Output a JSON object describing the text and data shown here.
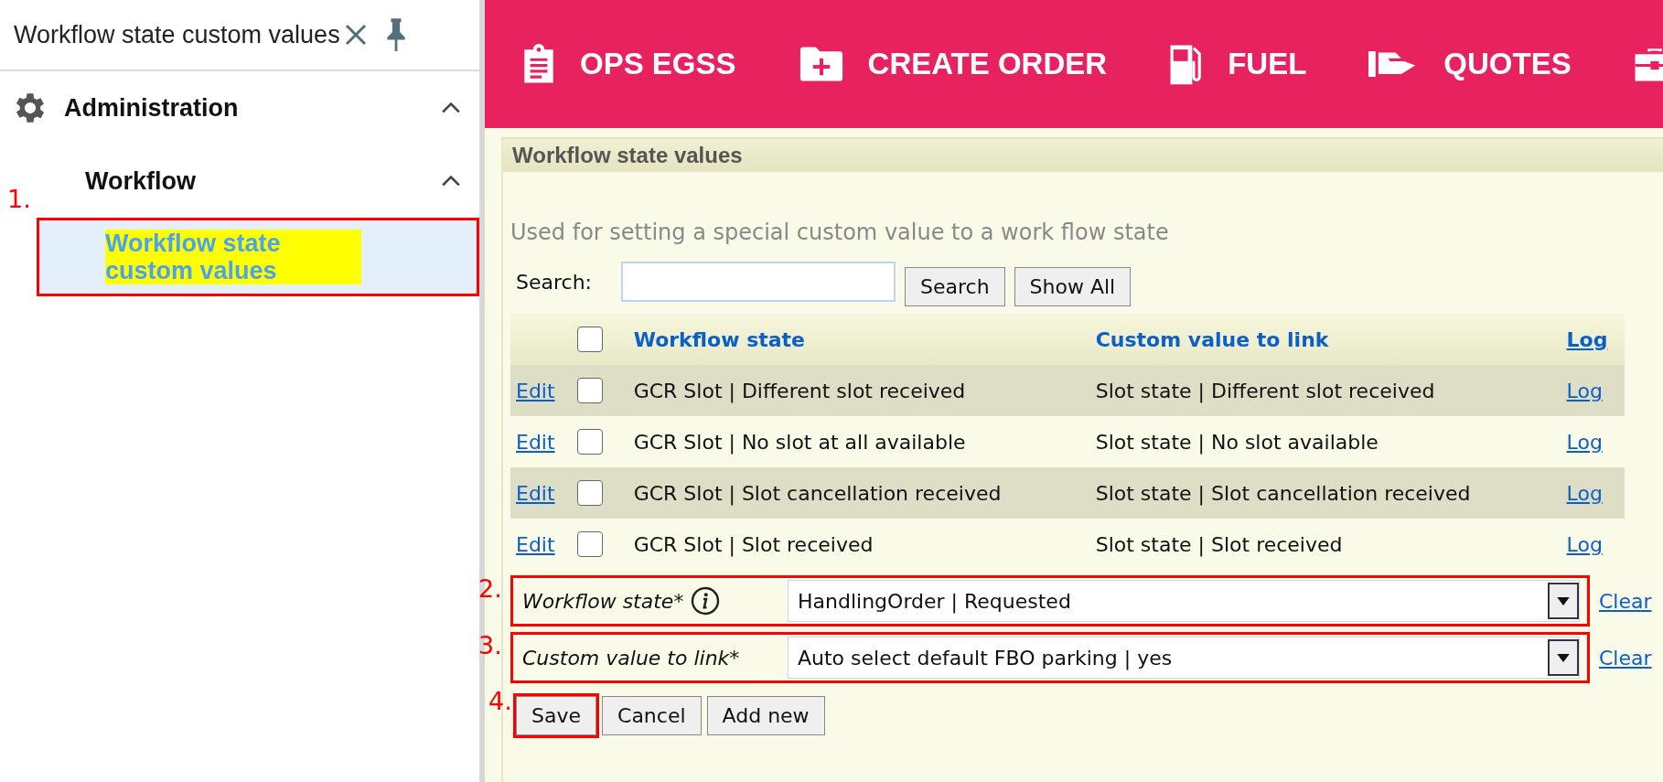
{
  "sidebar": {
    "title": "Workflow state custom values",
    "groups": [
      {
        "label": "Administration",
        "expanded": true,
        "children": [
          {
            "label": "Workflow",
            "expanded": true,
            "children": [
              {
                "label": "Workflow state custom values",
                "selected": true,
                "highlighted": true,
                "marker": "1."
              }
            ]
          }
        ]
      }
    ]
  },
  "nav": {
    "items": [
      {
        "label": "OPS EGSS"
      },
      {
        "label": "CREATE ORDER"
      },
      {
        "label": "FUEL"
      },
      {
        "label": "QUOTES"
      }
    ]
  },
  "panel": {
    "title": "Workflow state values",
    "description": "Used for setting a special custom value to a work flow state",
    "search": {
      "label": "Search:",
      "buttons": [
        "Search",
        "Show All"
      ]
    },
    "table": {
      "header_checked": false,
      "columns": [
        "Workflow state",
        "Custom value to link",
        "Log"
      ],
      "rows": [
        {
          "edit": "Edit",
          "checked": false,
          "workflow_state": "GCR Slot | Different slot received",
          "custom_value": "Slot state | Different slot received",
          "log": "Log"
        },
        {
          "edit": "Edit",
          "checked": false,
          "workflow_state": "GCR Slot | No slot at all available",
          "custom_value": "Slot state | No slot available",
          "log": "Log"
        },
        {
          "edit": "Edit",
          "checked": false,
          "workflow_state": "GCR Slot | Slot cancellation received",
          "custom_value": "Slot state | Slot cancellation received",
          "log": "Log"
        },
        {
          "edit": "Edit",
          "checked": false,
          "workflow_state": "GCR Slot | Slot received",
          "custom_value": "Slot state | Slot received",
          "log": "Log"
        }
      ]
    },
    "form": {
      "fields": [
        {
          "label": "Workflow state*",
          "info": true,
          "value": "HandlingOrder | Requested",
          "clear": "Clear",
          "marker": "2."
        },
        {
          "label": "Custom value to link*",
          "info": false,
          "value": "Auto select default FBO parking | yes",
          "clear": "Clear",
          "marker": "3."
        }
      ],
      "buttons": [
        {
          "label": "Save",
          "marker": "4."
        },
        {
          "label": "Cancel"
        },
        {
          "label": "Add new"
        }
      ]
    }
  }
}
